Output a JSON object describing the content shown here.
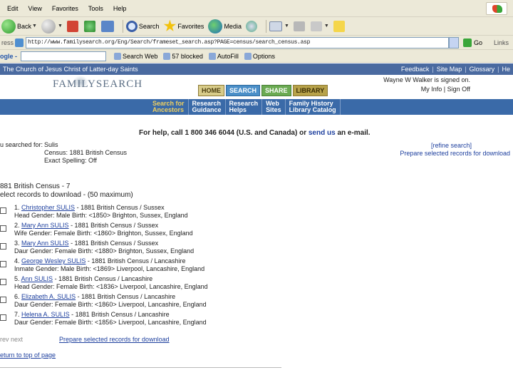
{
  "browser": {
    "menu": [
      "Edit",
      "View",
      "Favorites",
      "Tools",
      "Help"
    ],
    "toolbar": {
      "back_label": "Back",
      "search_label": "Search",
      "favorites_label": "Favorites",
      "media_label": "Media"
    },
    "address": {
      "label": "ress",
      "url": "http://www.familysearch.org/Eng/Search/frameset_search.asp?PAGE=census/search_census.asp",
      "go_label": "Go",
      "links_label": "Links"
    },
    "google_bar": {
      "logo": "ogle -",
      "search_web": "Search Web",
      "blocked": "57 blocked",
      "autofill": "AutoFill",
      "options": "Options"
    }
  },
  "lds": {
    "title": "The Church of Jesus Christ of Latter-day Saints",
    "links": [
      "Feedback",
      "Site Map",
      "Glossary",
      "He"
    ]
  },
  "header": {
    "logo": "FAMILYSEARCH",
    "tabs": [
      "HOME",
      "SEARCH",
      "SHARE",
      "LIBRARY"
    ],
    "signed_in": "Wayne W Walker is signed on.",
    "my_info": "My Info",
    "sign_off": "Sign Off"
  },
  "subnav": [
    {
      "line1": "Search for",
      "line2": "Ancestors"
    },
    {
      "line1": "Research",
      "line2": "Guidance"
    },
    {
      "line1": "Research",
      "line2": "Helps"
    },
    {
      "line1": "Web",
      "line2": "Sites"
    },
    {
      "line1": "Family History",
      "line2": "Library Catalog"
    }
  ],
  "help": {
    "text": "For help, call 1 800 346 6044 (U.S. and Canada) or ",
    "link": "send us",
    "tail": " an e-mail."
  },
  "search": {
    "label": "u searched for:",
    "surname": "Sulis",
    "census": "Census: 1881 British Census",
    "exact": "Exact Spelling: Off",
    "refine": "[refine search]",
    "prepare": "Prepare selected records for download"
  },
  "results": {
    "title": "881 British Census - 7",
    "note": "elect records to download - (50 maximum)",
    "records": [
      {
        "num": "1.",
        "name": "Christopher SULIS",
        "census": " - 1881 British Census / Sussex",
        "detail": "Head   Gender: Male   Birth: <1850> Brighton, Sussex, England"
      },
      {
        "num": "2.",
        "name": "Mary Ann SULIS",
        "census": " - 1881 British Census / Sussex",
        "detail": "Wife   Gender: Female   Birth: <1860> Brighton, Sussex, England"
      },
      {
        "num": "3.",
        "name": "Mary Ann SULIS",
        "census": " - 1881 British Census / Sussex",
        "detail": "Daur   Gender: Female   Birth: <1880> Brighton, Sussex, England"
      },
      {
        "num": "4.",
        "name": "George Wesley SULIS",
        "census": " - 1881 British Census / Lancashire",
        "detail": "Inmate   Gender: Male   Birth: <1869> Liverpool, Lancashire, England"
      },
      {
        "num": "5.",
        "name": "Ann SULIS",
        "census": " - 1881 British Census / Lancashire",
        "detail": "Head   Gender: Female   Birth: <1836> Liverpool, Lancashire, England"
      },
      {
        "num": "6.",
        "name": "Elizabeth A. SULIS",
        "census": " - 1881 British Census / Lancashire",
        "detail": "Daur   Gender: Female   Birth: <1860> Liverpool, Lancashire, England"
      },
      {
        "num": "7.",
        "name": "Helena A. SULIS",
        "census": " - 1881 British Census / Lancashire",
        "detail": "Daur   Gender: Female   Birth: <1856> Liverpool, Lancashire, England"
      }
    ],
    "prev_next": "rev   next",
    "prepare": "Prepare selected records for download",
    "return_top": "eturn to top of page"
  }
}
